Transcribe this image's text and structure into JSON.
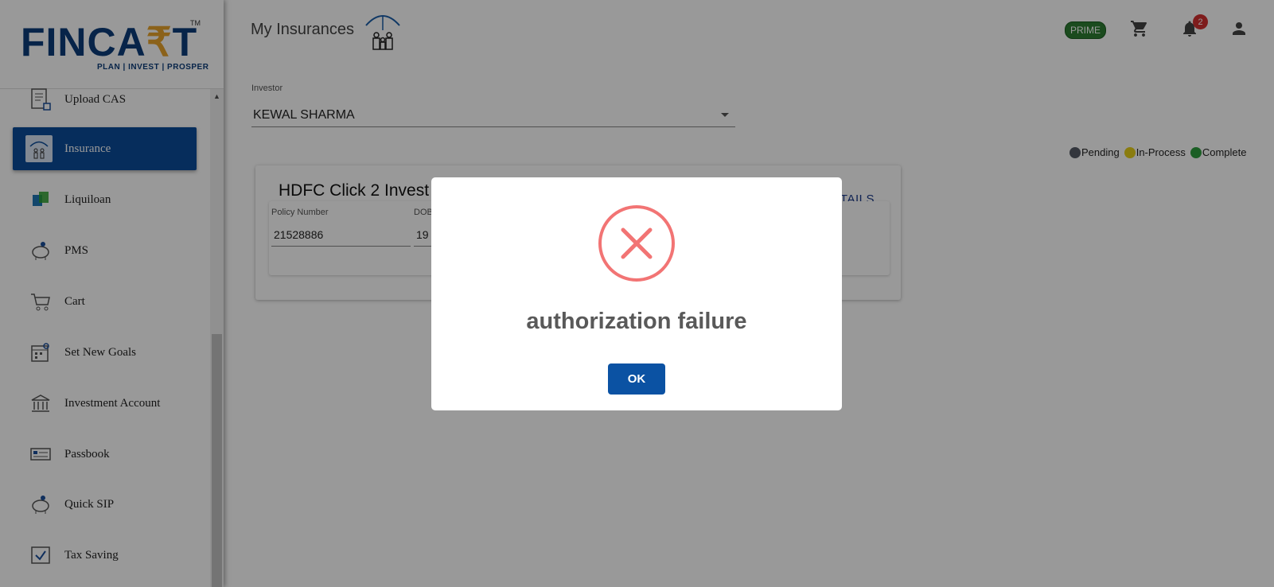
{
  "brand": {
    "logo_text_a": "FINCA",
    "logo_text_r": "₹",
    "logo_text_b": "T",
    "tm": "TM",
    "tagline": "PLAN | INVEST | PROSPER"
  },
  "sidebar": {
    "items": [
      {
        "label": "Upload CAS",
        "icon": "document-upload-icon"
      },
      {
        "label": "Insurance",
        "icon": "family-umbrella-icon",
        "active": true
      },
      {
        "label": "Liquiloan",
        "icon": "liquiloan-icon"
      },
      {
        "label": "PMS",
        "icon": "piggy-bank-icon"
      },
      {
        "label": "Cart",
        "icon": "cart-icon"
      },
      {
        "label": "Set New Goals",
        "icon": "calendar-goal-icon"
      },
      {
        "label": "Investment Account",
        "icon": "bank-icon"
      },
      {
        "label": "Passbook",
        "icon": "passbook-icon"
      },
      {
        "label": "Quick SIP",
        "icon": "piggy-bank-icon"
      },
      {
        "label": "Tax Saving",
        "icon": "tax-saving-icon"
      }
    ]
  },
  "header": {
    "title": "My Insurances",
    "prime_label": "PRIME",
    "notification_count": "2"
  },
  "investor": {
    "label": "Investor",
    "selected": "KEWAL SHARMA"
  },
  "legend": [
    {
      "label": "Pending",
      "color": "#555b66"
    },
    {
      "label": "In-Process",
      "color": "#e6cf1a"
    },
    {
      "label": "Complete",
      "color": "#2e9e3e"
    }
  ],
  "policy_card": {
    "title": "HDFC Click 2 Invest",
    "details_link": "TAILS",
    "policy_number_label": "Policy Number",
    "policy_number": "21528886",
    "dob_label": "DOB",
    "dob_value": "19"
  },
  "dialog": {
    "title": "authorization failure",
    "ok_label": "OK",
    "icon": "error-x-icon",
    "icon_color": "#f27474",
    "button_color": "#0b52a3"
  }
}
